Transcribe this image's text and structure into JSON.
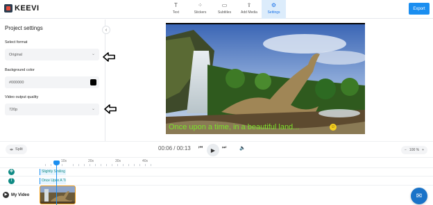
{
  "app": {
    "logo_text": "KEEVI"
  },
  "toolbar": {
    "tabs": [
      {
        "label": "Text",
        "icon": "text-icon"
      },
      {
        "label": "Stickers",
        "icon": "stickers-icon"
      },
      {
        "label": "Subtitles",
        "icon": "subtitles-icon"
      },
      {
        "label": "Add Media",
        "icon": "upload-icon"
      },
      {
        "label": "Settings",
        "icon": "gear-icon",
        "active": true
      }
    ],
    "export_label": "Export"
  },
  "settings": {
    "title": "Project settings",
    "format_label": "Select format",
    "format_value": "Original",
    "bg_label": "Background color",
    "bg_value": "#000000",
    "bg_swatch": "#000000",
    "quality_label": "Video output quality",
    "quality_value": "720p"
  },
  "preview": {
    "caption": "Once upon a time, in a beautiful land..."
  },
  "controls": {
    "split_label": "Split",
    "current_time": "00:06",
    "total_time": "00:13",
    "zoom_label": "100 %"
  },
  "timeline": {
    "ruler_labels": [
      "10s",
      "20s",
      "30s",
      "40s"
    ],
    "sticker_track_label": "Slightly Smiling Fa",
    "text_track_label": "Once Upon A Time",
    "video_track_label": "My Video"
  },
  "colors": {
    "accent": "#1a8ef0",
    "track_teal": "#0f8a84",
    "caption_green": "#7be22b",
    "clip_border": "#f0a020"
  }
}
